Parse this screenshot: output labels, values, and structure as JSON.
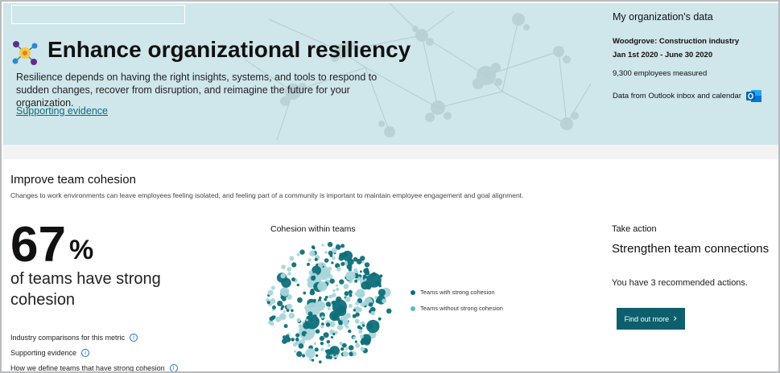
{
  "hero": {
    "title": "Enhance organizational resiliency",
    "description": "Resilience depends on having the right insights, systems, and tools to respond to sudden changes, recover from disruption, and reimagine the future for your organization.",
    "link": "Supporting evidence",
    "icon": "network-hub-icon"
  },
  "org": {
    "title": "My organization's data",
    "company": "Woodgrove:  Construction industry",
    "dates": "Jan 1st 2020 - June 30 2020",
    "employees": "9,300 employees measured",
    "source": "Data from Outlook inbox and calendar",
    "source_icon": "outlook-icon"
  },
  "section": {
    "title": "Improve team cohesion",
    "description": "Changes to work environments can leave employees feeling isolated, and feeling part of a community is important to maintain employee engagement and goal alignment."
  },
  "metric": {
    "value": "67",
    "unit": "%",
    "caption": "of teams have strong cohesion"
  },
  "info_links": [
    {
      "label": "Industry comparisons for this metric",
      "icon": "info-icon"
    },
    {
      "label": "Supporting evidence",
      "icon": "info-icon"
    },
    {
      "label": "How we define teams that have strong cohesion",
      "icon": "info-icon"
    }
  ],
  "chart": {
    "title": "Cohesion within teams",
    "legend": [
      {
        "label": "Teams with strong cohesion",
        "color": "#0e6f7a"
      },
      {
        "label": "Teams without strong cohesion",
        "color": "#7fc4cb"
      }
    ]
  },
  "action": {
    "label": "Take action",
    "title": "Strengthen team connections",
    "text": "You have 3 recommended actions.",
    "button": "Find out more"
  },
  "colors": {
    "hero_bg": "#cfe6ea",
    "accent": "#0e5f6d",
    "link": "#0b6a80",
    "bubble_dark": "#0e6f7a",
    "bubble_light": "#a8d6db"
  }
}
